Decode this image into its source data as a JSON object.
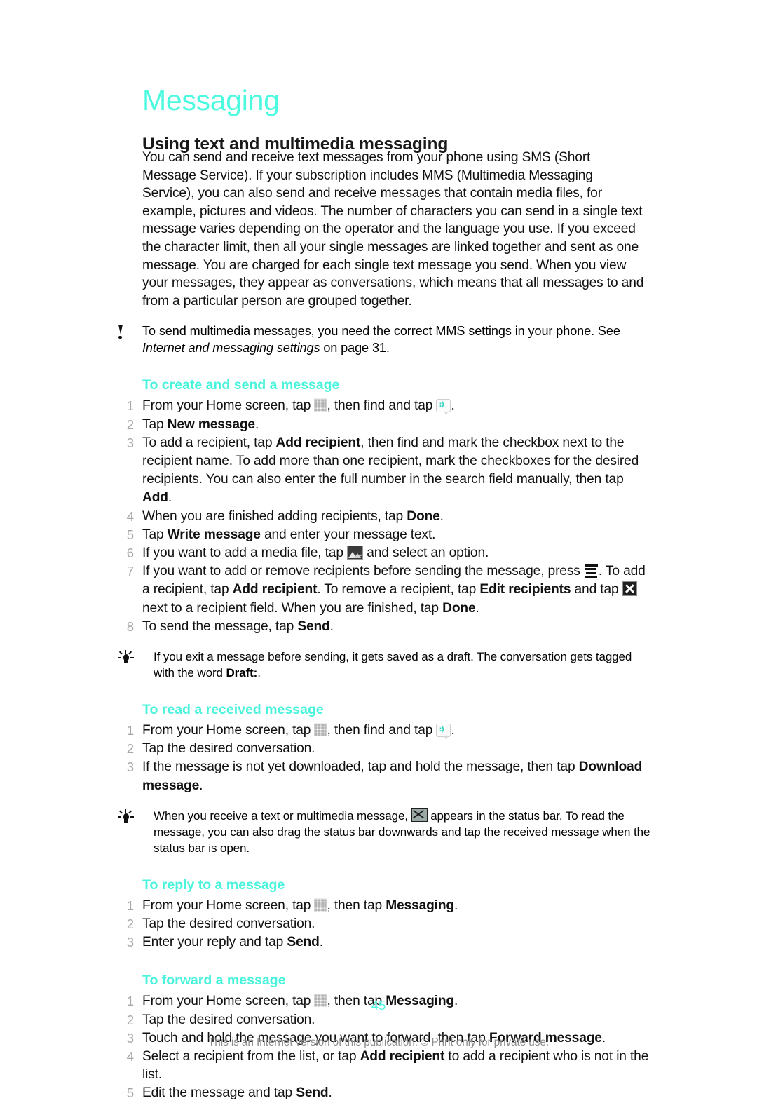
{
  "document": {
    "chapter_title": "Messaging",
    "section_title": "Using text and multimedia messaging",
    "intro_paragraph": "You can send and receive text messages from your phone using SMS (Short Message Service). If your subscription includes MMS (Multimedia Messaging Service), you can also send and receive messages that contain media files, for example, pictures and videos. The number of characters you can send in a single text message varies depending on the operator and the language you use. If you exceed the character limit, then all your single messages are linked together and sent as one message. You are charged for each single text message you send. When you view your messages, they appear as conversations, which means that all messages to and from a particular person are grouped together."
  },
  "note_mms": {
    "icon": "exclamation-icon",
    "text_before": "To send multimedia messages, you need the correct MMS settings in your phone. See ",
    "italic_reference": "Internet and messaging settings",
    "text_after": " on page 31."
  },
  "procedures": [
    {
      "id": "create-and-send",
      "title": "To create and send a message",
      "steps": [
        {
          "num": "1",
          "parts": [
            {
              "t": "text",
              "v": "From your Home screen, tap "
            },
            {
              "t": "icon",
              "v": "app-drawer-grid-icon"
            },
            {
              "t": "text",
              "v": ", then find and tap "
            },
            {
              "t": "icon",
              "v": "messaging-bubble-icon"
            },
            {
              "t": "text",
              "v": "."
            }
          ]
        },
        {
          "num": "2",
          "parts": [
            {
              "t": "text",
              "v": "Tap "
            },
            {
              "t": "bold",
              "v": "New message"
            },
            {
              "t": "text",
              "v": "."
            }
          ]
        },
        {
          "num": "3",
          "parts": [
            {
              "t": "text",
              "v": "To add a recipient, tap "
            },
            {
              "t": "bold",
              "v": "Add recipient"
            },
            {
              "t": "text",
              "v": ", then find and mark the checkbox next to the recipient name. To add more than one recipient, mark the checkboxes for the desired recipients. You can also enter the full number in the search field manually, then tap "
            },
            {
              "t": "bold",
              "v": "Add"
            },
            {
              "t": "text",
              "v": "."
            }
          ]
        },
        {
          "num": "4",
          "parts": [
            {
              "t": "text",
              "v": "When you are finished adding recipients, tap "
            },
            {
              "t": "bold",
              "v": "Done"
            },
            {
              "t": "text",
              "v": "."
            }
          ]
        },
        {
          "num": "5",
          "parts": [
            {
              "t": "text",
              "v": "Tap "
            },
            {
              "t": "bold",
              "v": "Write message"
            },
            {
              "t": "text",
              "v": " and enter your message text."
            }
          ]
        },
        {
          "num": "6",
          "parts": [
            {
              "t": "text",
              "v": "If you want to add a media file, tap "
            },
            {
              "t": "icon",
              "v": "picture-media-icon"
            },
            {
              "t": "text",
              "v": " and select an option."
            }
          ]
        },
        {
          "num": "7",
          "parts": [
            {
              "t": "text",
              "v": "If you want to add or remove recipients before sending the message, press "
            },
            {
              "t": "icon",
              "v": "menu-icon"
            },
            {
              "t": "text",
              "v": ". To add a recipient, tap "
            },
            {
              "t": "bold",
              "v": "Add recipient"
            },
            {
              "t": "text",
              "v": ". To remove a recipient, tap "
            },
            {
              "t": "bold",
              "v": "Edit recipients"
            },
            {
              "t": "text",
              "v": " and tap "
            },
            {
              "t": "icon",
              "v": "delete-x-icon"
            },
            {
              "t": "text",
              "v": " next to a recipient field. When you are finished, tap "
            },
            {
              "t": "bold",
              "v": "Done"
            },
            {
              "t": "text",
              "v": "."
            }
          ]
        },
        {
          "num": "8",
          "parts": [
            {
              "t": "text",
              "v": "To send the message, tap "
            },
            {
              "t": "bold",
              "v": "Send"
            },
            {
              "t": "text",
              "v": "."
            }
          ]
        }
      ]
    },
    {
      "id": "read-received",
      "title": "To read a received message",
      "steps": [
        {
          "num": "1",
          "parts": [
            {
              "t": "text",
              "v": "From your Home screen, tap "
            },
            {
              "t": "icon",
              "v": "app-drawer-grid-icon"
            },
            {
              "t": "text",
              "v": ", then find and tap "
            },
            {
              "t": "icon",
              "v": "messaging-bubble-icon"
            },
            {
              "t": "text",
              "v": "."
            }
          ]
        },
        {
          "num": "2",
          "parts": [
            {
              "t": "text",
              "v": "Tap the desired conversation."
            }
          ]
        },
        {
          "num": "3",
          "parts": [
            {
              "t": "text",
              "v": "If the message is not yet downloaded, tap and hold the message, then tap "
            },
            {
              "t": "bold",
              "v": "Download message"
            },
            {
              "t": "text",
              "v": "."
            }
          ]
        }
      ]
    },
    {
      "id": "reply",
      "title": "To reply to a message",
      "steps": [
        {
          "num": "1",
          "parts": [
            {
              "t": "text",
              "v": "From your Home screen, tap "
            },
            {
              "t": "icon",
              "v": "app-drawer-grid-icon"
            },
            {
              "t": "text",
              "v": ", then tap "
            },
            {
              "t": "bold",
              "v": "Messaging"
            },
            {
              "t": "text",
              "v": "."
            }
          ]
        },
        {
          "num": "2",
          "parts": [
            {
              "t": "text",
              "v": "Tap the desired conversation."
            }
          ]
        },
        {
          "num": "3",
          "parts": [
            {
              "t": "text",
              "v": "Enter your reply and tap "
            },
            {
              "t": "bold",
              "v": "Send"
            },
            {
              "t": "text",
              "v": "."
            }
          ]
        }
      ]
    },
    {
      "id": "forward",
      "title": "To forward a message",
      "steps": [
        {
          "num": "1",
          "parts": [
            {
              "t": "text",
              "v": "From your Home screen, tap "
            },
            {
              "t": "icon",
              "v": "app-drawer-grid-icon"
            },
            {
              "t": "text",
              "v": ", then tap "
            },
            {
              "t": "bold",
              "v": "Messaging"
            },
            {
              "t": "text",
              "v": "."
            }
          ]
        },
        {
          "num": "2",
          "parts": [
            {
              "t": "text",
              "v": "Tap the desired conversation."
            }
          ]
        },
        {
          "num": "3",
          "parts": [
            {
              "t": "text",
              "v": "Touch and hold the message you want to forward, then tap "
            },
            {
              "t": "bold",
              "v": "Forward message"
            },
            {
              "t": "text",
              "v": "."
            }
          ]
        },
        {
          "num": "4",
          "parts": [
            {
              "t": "text",
              "v": "Select a recipient from the list, or tap "
            },
            {
              "t": "bold",
              "v": "Add recipient"
            },
            {
              "t": "text",
              "v": " to add a recipient who is not in the list."
            }
          ]
        },
        {
          "num": "5",
          "parts": [
            {
              "t": "text",
              "v": "Edit the message and tap "
            },
            {
              "t": "bold",
              "v": "Send"
            },
            {
              "t": "text",
              "v": "."
            }
          ]
        }
      ]
    }
  ],
  "tip_draft": {
    "icon": "lightbulb-icon",
    "parts": [
      {
        "t": "text",
        "v": "If you exit a message before sending, it gets saved as a draft. The conversation gets tagged with the word "
      },
      {
        "t": "bold",
        "v": "Draft:"
      },
      {
        "t": "text",
        "v": "."
      }
    ]
  },
  "tip_status_bar": {
    "icon": "lightbulb-icon",
    "parts": [
      {
        "t": "text",
        "v": "When you receive a text or multimedia message, "
      },
      {
        "t": "icon",
        "v": "envelope-icon"
      },
      {
        "t": "text",
        "v": " appears in the status bar. To read the message, you can also drag the status bar downwards and tap the received message when the status bar is open."
      }
    ]
  },
  "footer": {
    "page_number": "45",
    "notice": "This is an Internet version of this publication. © Print only for private use."
  },
  "colors": {
    "accent_cyan": "#4CFADF",
    "heading_cyan": "#49F3DC",
    "step_number_gray": "#A7A7A7",
    "footer_gray": "#8d8d8d",
    "body_black": "#111111"
  }
}
